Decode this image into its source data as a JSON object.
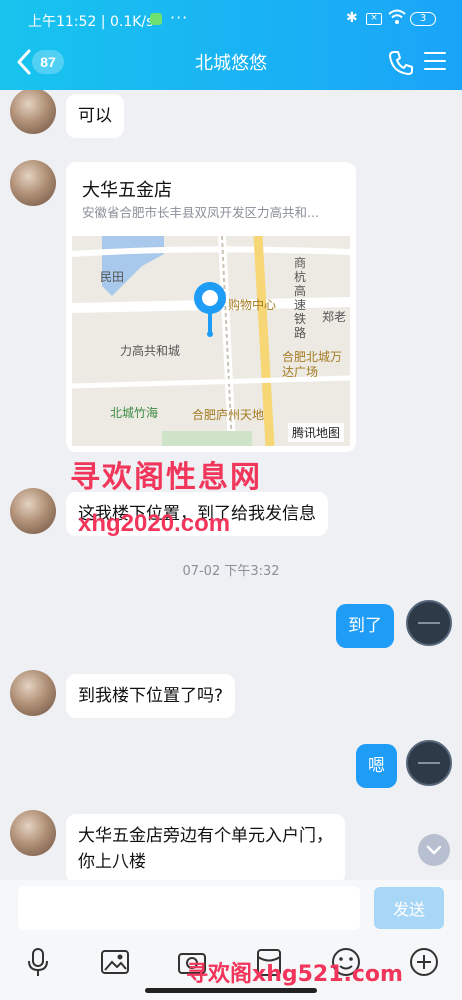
{
  "status_bar": {
    "time": "上午11:52 | 0.1K/s",
    "more": "···",
    "battery": "3"
  },
  "header": {
    "unread_count": "87",
    "title": "北城悠悠"
  },
  "messages": {
    "m1": "可以",
    "location": {
      "name": "大华五金店",
      "address": "安徽省合肥市长丰县双凤开发区力高共和...",
      "map_labels": [
        "民田",
        "购物中心",
        "商杭高速铁路",
        "郑老",
        "力高共和城",
        "合肥北城万达广场",
        "北城竹海",
        "合肥庐州天地"
      ],
      "map_provider": "腾讯地图"
    },
    "m2": "这我楼下位置，到了给我发信息",
    "timestamp": "07-02 下午3:32",
    "m3": "到了",
    "m4": "到我楼下位置了吗?",
    "m5": "嗯",
    "m6_line1": "大华五金店旁边有个单元入户门，",
    "m6_line2": "你上八楼"
  },
  "watermarks": {
    "line1": "寻欢阁性息网",
    "line2": "xhg2020.com",
    "line3": "寻欢阁xhg521.com"
  },
  "input": {
    "placeholder": "",
    "send_label": "发送"
  },
  "colors": {
    "header_start": "#18c4ee",
    "header_end": "#1aa4f8",
    "sent_bubble": "#1e9cf6",
    "send_button": "#a8d6f6"
  }
}
